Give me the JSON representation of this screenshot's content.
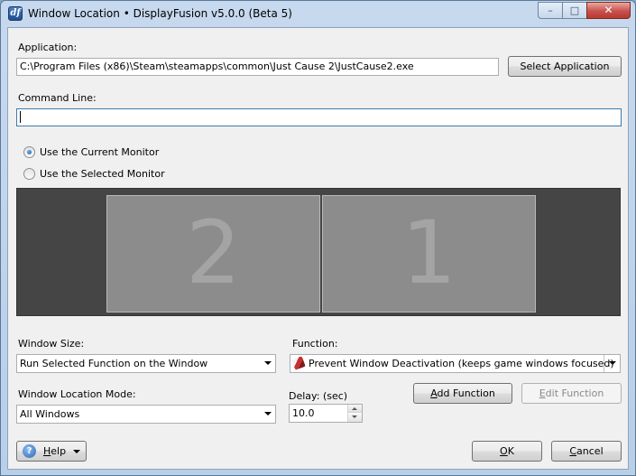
{
  "window": {
    "title": "Window Location • DisplayFusion v5.0.0 (Beta 5)",
    "app_icon_glyph": "df"
  },
  "titlebar": {
    "minimize_glyph": "–",
    "maximize_glyph": "□",
    "close_glyph": "✕"
  },
  "application": {
    "label": "Application:",
    "value": "C:\\Program Files (x86)\\Steam\\steamapps\\common\\Just Cause 2\\JustCause2.exe",
    "select_button": "Select Application"
  },
  "command_line": {
    "label": "Command Line:",
    "value": ""
  },
  "monitor_mode": {
    "options": [
      {
        "label": "Use the Current Monitor",
        "selected": true
      },
      {
        "label": "Use the Selected Monitor",
        "selected": false
      }
    ]
  },
  "monitors": [
    {
      "number": "2"
    },
    {
      "number": "1"
    }
  ],
  "window_size": {
    "label": "Window Size:",
    "selected": "Run Selected Function on the Window"
  },
  "function": {
    "label": "Function:",
    "selected": "Prevent Window Deactivation (keeps game windows focused)",
    "icon": "red-pencil-icon"
  },
  "location_mode": {
    "label": "Window Location Mode:",
    "selected": "All Windows"
  },
  "delay": {
    "label": "Delay: (sec)",
    "value": "10.0"
  },
  "buttons": {
    "add_function_prefix": "A",
    "add_function_rest": "dd Function",
    "edit_function_prefix": "E",
    "edit_function_rest": "dit Function",
    "help_prefix": "H",
    "help_rest": "elp",
    "ok_prefix": "O",
    "ok_rest": "K",
    "cancel_prefix": "C",
    "cancel_rest": "ancel"
  },
  "colors": {
    "monitor_area_bg": "#454545",
    "monitor_bg": "#8c8c8c",
    "close_button": "#c75050"
  }
}
